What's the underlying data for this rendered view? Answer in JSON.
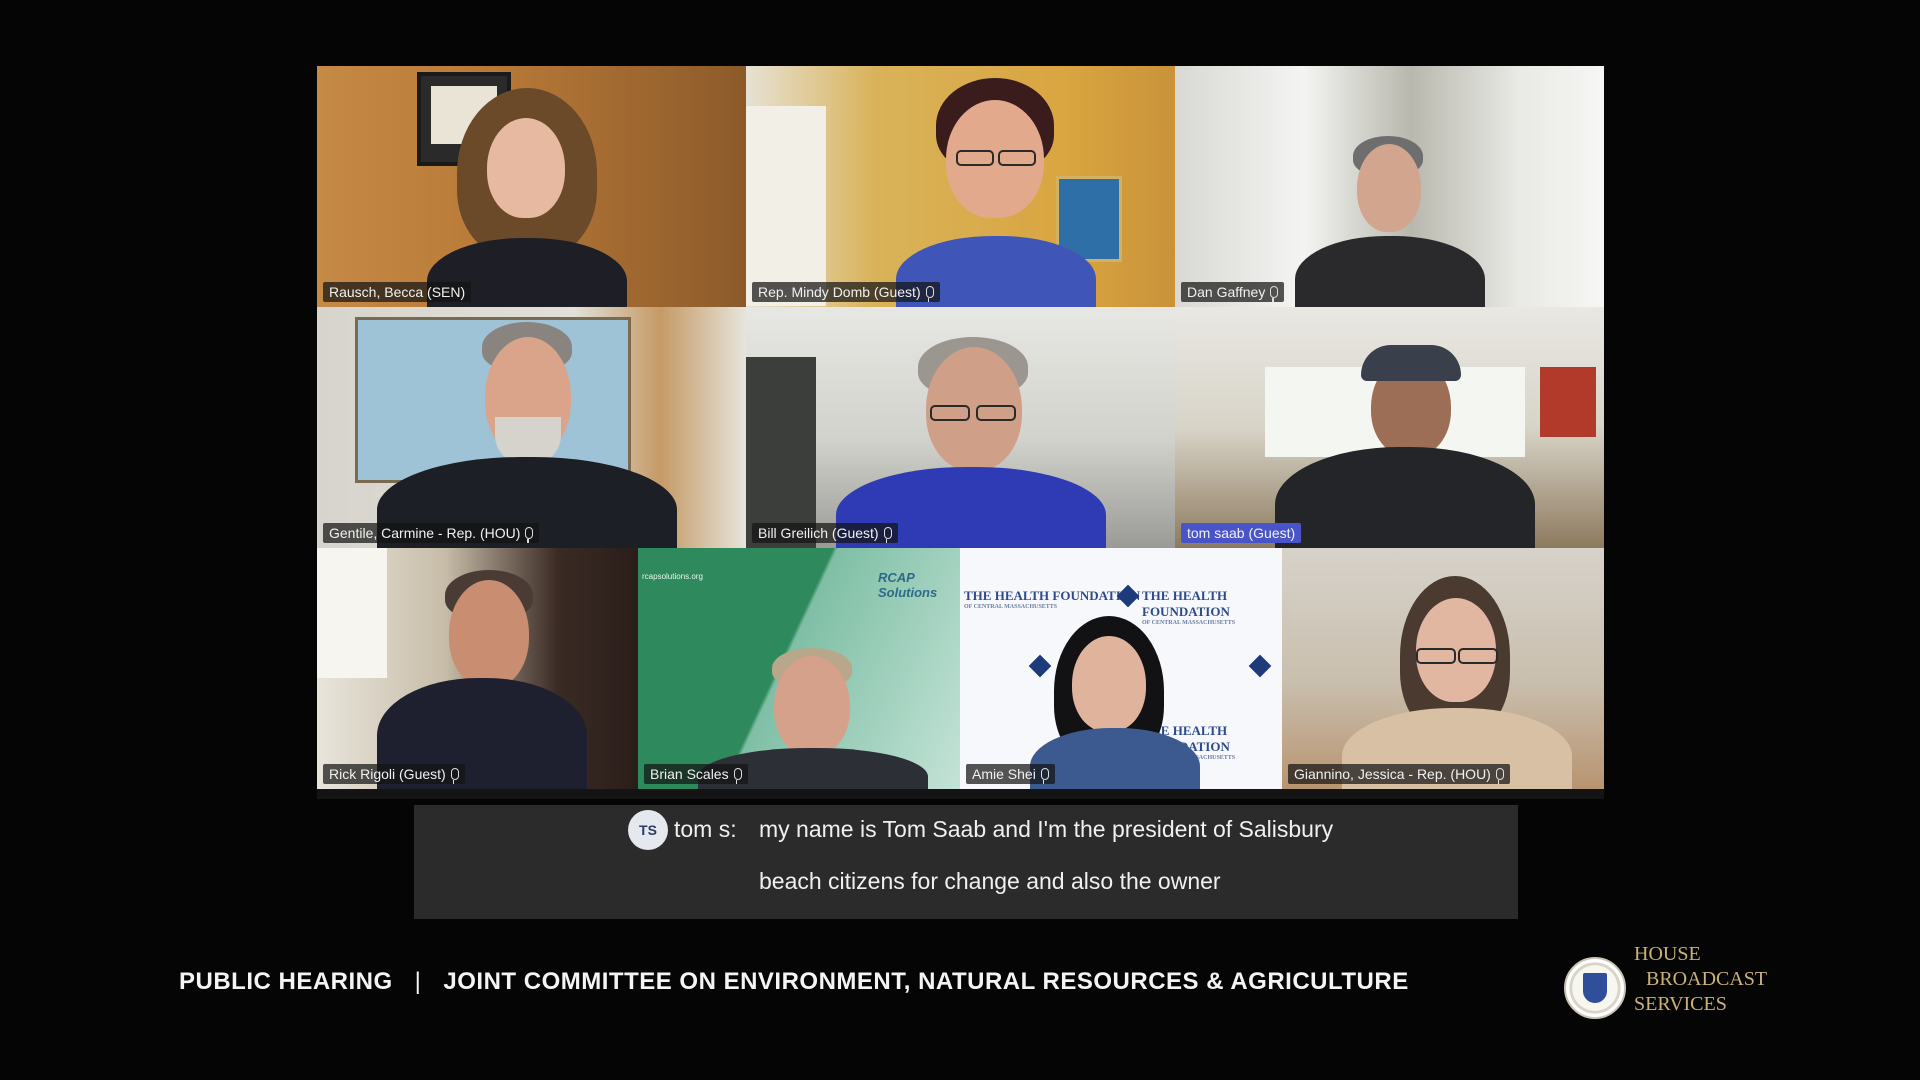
{
  "participants": [
    {
      "name": "Rausch, Becca (SEN)",
      "mic": false,
      "highlight": false
    },
    {
      "name": "Rep. Mindy Domb (Guest)",
      "mic": true,
      "highlight": false
    },
    {
      "name": "Dan Gaffney",
      "mic": true,
      "highlight": false
    },
    {
      "name": "Gentile, Carmine - Rep. (HOU)",
      "mic": true,
      "highlight": false
    },
    {
      "name": "Bill Greilich (Guest)",
      "mic": true,
      "highlight": false
    },
    {
      "name": "tom saab (Guest)",
      "mic": false,
      "highlight": true
    },
    {
      "name": "Rick Rigoli (Guest)",
      "mic": true,
      "highlight": false
    },
    {
      "name": "Brian Scales",
      "mic": true,
      "highlight": false
    },
    {
      "name": "Amie Shei",
      "mic": true,
      "highlight": false
    },
    {
      "name": "Giannino, Jessica - Rep. (HOU)",
      "mic": true,
      "highlight": false
    }
  ],
  "backdrop": {
    "foundation_name": "THE HEALTH FOUNDATION",
    "foundation_sub": "OF CENTRAL MASSACHUSETTS",
    "rcap_logo": "RCAP Solutions",
    "rcap_url": "rcapsolutions.org"
  },
  "caption": {
    "avatar_initials": "TS",
    "speaker": "tom s:",
    "line1": "my name is Tom Saab and I'm the president of Salisbury",
    "line2": "beach citizens for change and also the owner"
  },
  "lower_third": {
    "left": "PUBLIC HEARING",
    "separator": "|",
    "right": "JOINT COMMITTEE ON ENVIRONMENT, NATURAL RESOURCES & AGRICULTURE"
  },
  "brand": {
    "line1": "HOUSE",
    "line2": "BROADCAST",
    "line3": "SERVICES"
  }
}
